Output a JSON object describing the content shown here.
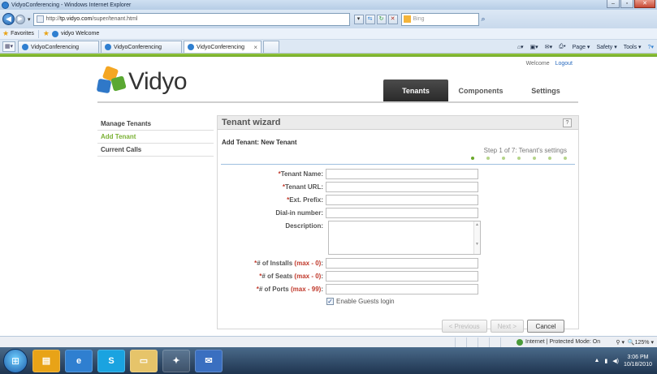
{
  "browser": {
    "window_title": "VidyoConferencing - Windows Internet Explorer",
    "url_prefix": "http://",
    "url_domain": "tp.vidyo.com",
    "url_path": "/super/tenant.html",
    "search_placeholder": "Bing",
    "favorites_label": "Favorites",
    "favorite_link": "vidyo Welcome",
    "tabs": [
      {
        "label": "VidyoConferencing",
        "active": false
      },
      {
        "label": "VidyoConferencing",
        "active": false
      },
      {
        "label": "VidyoConferencing",
        "active": true
      }
    ],
    "tab_close": "×",
    "commands": [
      "Page ▾",
      "Safety ▾",
      "Tools ▾"
    ],
    "status_zone": "Internet | Protected Mode: On",
    "zoom": "125%"
  },
  "header": {
    "welcome": "Welcome",
    "logout": "Logout",
    "logo_text": "Vidyo"
  },
  "nav": {
    "tabs": [
      {
        "label": "Tenants",
        "active": true
      },
      {
        "label": "Components",
        "active": false
      },
      {
        "label": "Settings",
        "active": false
      }
    ]
  },
  "sidebar": {
    "items": [
      {
        "label": "Manage Tenants",
        "active": false
      },
      {
        "label": "Add Tenant",
        "active": true
      },
      {
        "label": "Current Calls",
        "active": false
      }
    ]
  },
  "wizard": {
    "title": "Tenant wizard",
    "help": "?",
    "subtitle": "Add Tenant: New Tenant",
    "step": "Step 1 of 7: Tenant's settings",
    "step_count": 7,
    "current_step": 1,
    "fields": {
      "tenant_name": {
        "req": "*",
        "label": "Tenant Name:"
      },
      "tenant_url": {
        "req": "*",
        "label": "Tenant URL:"
      },
      "ext_prefix": {
        "req": "*",
        "label": "Ext. Prefix:"
      },
      "dial_in": {
        "label": "Dial-in number:"
      },
      "description": {
        "label": "Description:"
      },
      "installs": {
        "req": "*",
        "label": "# of Installs ",
        "max": "(max - 0)",
        "colon": ":"
      },
      "seats": {
        "req": "*",
        "label": "# of Seats ",
        "max": "(max - 0)",
        "colon": ":"
      },
      "ports": {
        "req": "*",
        "label": "# of Ports ",
        "max": "(max - 99)",
        "colon": ":"
      }
    },
    "guests_label": "Enable Guests login",
    "guests_checked": true,
    "buttons": {
      "previous": "< Previous",
      "next": "Next >",
      "cancel": "Cancel"
    }
  },
  "taskbar": {
    "time": "3:06 PM",
    "date": "10/18/2010"
  },
  "colors": {
    "accent_green": "#7ab134",
    "required_red": "#c0392b",
    "nav_active": "#333333"
  }
}
